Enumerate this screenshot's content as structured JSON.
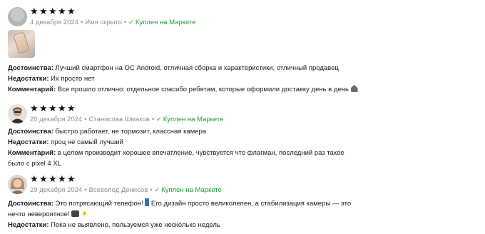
{
  "reviews": [
    {
      "rating": 5,
      "date": "4 декабря 2024",
      "author": "Имя скрыто",
      "bought_label": "Куплен на Маркете",
      "has_photo": true,
      "pros_label": "Достоинства:",
      "pros": "Лучший смартфон на ОС Android, отличная сборка и характеристики, отличный продавец",
      "cons_label": "Недостатки:",
      "cons": "Их просто нет",
      "comment_label": "Комментарий:",
      "comment": "Все прошло отлично: отдельное спасибо ребятам, которые оформили доставку день в день"
    },
    {
      "rating": 5,
      "date": "20 декабря 2024",
      "author": "Станислав Шмаков",
      "bought_label": "Куплен на Маркете",
      "pros_label": "Достоинства:",
      "pros": "быстро работает, не тормозит, классная камера",
      "cons_label": "Недостатки:",
      "cons": "проц не самый лучший",
      "comment_label": "Комментарий:",
      "comment_line1": "в целом производит хорошее впечатление, чувствуется что флагман, последний раз такое",
      "comment_line2": "было с pixel 4 XL"
    },
    {
      "rating": 5,
      "date": "29 декабря 2024",
      "author": "Всеволод Денисов",
      "bought_label": "Куплен на Маркете",
      "pros_label": "Достоинства:",
      "pros_part1": "Это потрясающий телефон!",
      "pros_part2": "Его дизайн просто великолепен, а стабилизация камеры — это",
      "pros_line2": "нечто невероятное!",
      "cons_label": "Недостатки:",
      "cons": "Пока не выявлено, пользуемся уже несколько недель"
    }
  ],
  "icons": {
    "star": "star-icon",
    "check": "check-icon"
  },
  "colors": {
    "bought": "#1f9d3a",
    "meta": "#8f8f8f",
    "star": "#111111"
  }
}
